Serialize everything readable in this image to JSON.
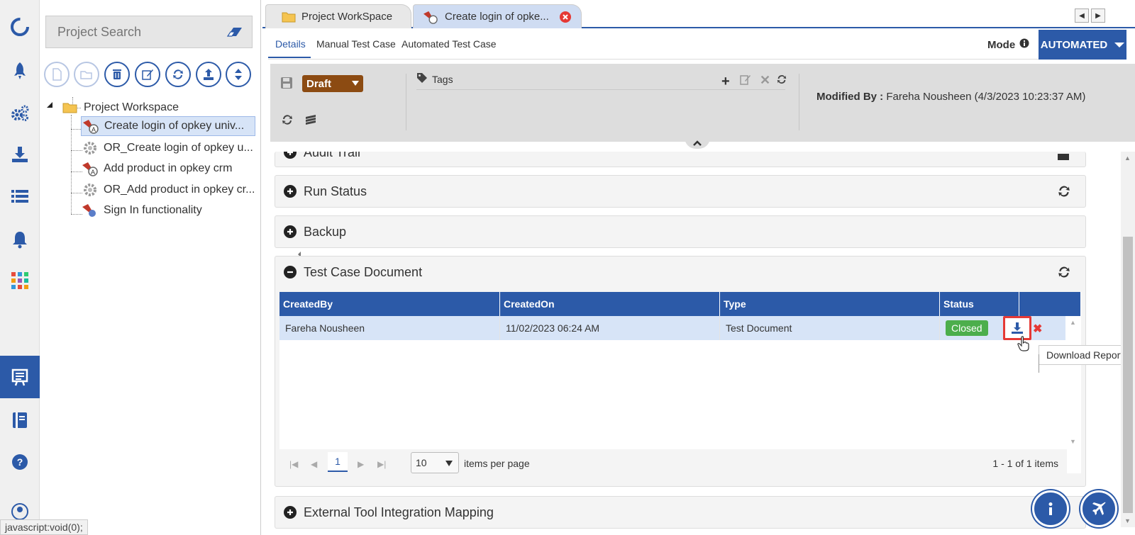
{
  "rail": {
    "items": [
      "logo",
      "launch",
      "settings",
      "download",
      "list",
      "notifications",
      "apps",
      "test-manager",
      "book",
      "help",
      "profile"
    ]
  },
  "tree": {
    "search_placeholder": "Project Search",
    "root": "Project Workspace",
    "items": [
      {
        "label": "Create login of opkey univ..."
      },
      {
        "label": "OR_Create login of opkey u..."
      },
      {
        "label": "Add product in opkey crm"
      },
      {
        "label": "OR_Add product in opkey cr..."
      },
      {
        "label": "Sign In functionality"
      }
    ]
  },
  "status_url": "javascript:void(0);",
  "tabs": [
    {
      "label": "Project WorkSpace"
    },
    {
      "label": "Create login of opke..."
    }
  ],
  "subtabs": [
    "Details",
    "Manual Test Case",
    "Automated Test Case"
  ],
  "mode": {
    "label": "Mode",
    "value": "AUTOMATED"
  },
  "props": {
    "status": "Draft",
    "tags_label": "Tags",
    "modified_label": "Modified By :",
    "modified_value": "Fareha Nousheen (4/3/2023 10:23:37 AM)"
  },
  "panels": {
    "audit": "Audit Trail",
    "run_status": "Run Status",
    "backup": "Backup",
    "test_case_doc": "Test Case Document",
    "external": "External Tool Integration Mapping"
  },
  "grid": {
    "columns": [
      "CreatedBy",
      "CreatedOn",
      "Type",
      "Status"
    ],
    "rows": [
      {
        "created_by": "Fareha Nousheen",
        "created_on": "11/02/2023 06:24 AM",
        "type": "Test Document",
        "status": "Closed"
      }
    ]
  },
  "pager": {
    "page": "1",
    "page_size": "10",
    "per_page_label": "items per page",
    "info": "1 - 1 of 1 items"
  },
  "tooltip": "Download Report",
  "colors": {
    "accent": "#2c5aa8",
    "draft": "#8c4b12",
    "closed": "#4cae4c",
    "highlight": "#e53935"
  }
}
